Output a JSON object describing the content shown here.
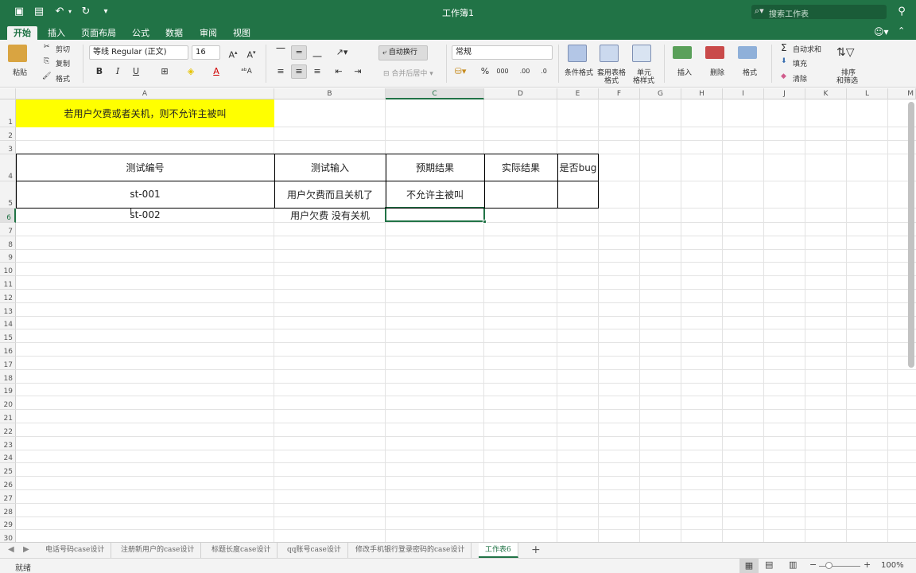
{
  "window": {
    "title": "工作簿1",
    "search_placeholder": "搜索工作表"
  },
  "colors": {
    "brand": "#217346",
    "highlight_yellow": "#ffff00"
  },
  "ribbon_tabs": [
    "开始",
    "插入",
    "页面布局",
    "公式",
    "数据",
    "审阅",
    "视图"
  ],
  "ribbon": {
    "paste": "粘贴",
    "cut": "剪切",
    "copy": "复制",
    "format_painter": "格式",
    "font_name": "等线 Regular (正文)",
    "font_size": "16",
    "wrap_text": "自动换行",
    "merge_center": "合并后居中",
    "number_format": "常规",
    "percent": "%",
    "thousands": "000",
    "inc_decimal": ".00",
    "dec_decimal": ".0",
    "conditional_format": "条件格式",
    "table_format_1": "套用表格",
    "table_format_2": "格式",
    "cell_style_1": "单元",
    "cell_style_2": "格样式",
    "insert": "插入",
    "delete": "删除",
    "format": "格式",
    "autosum": "自动求和",
    "fill": "填充",
    "clear": "清除",
    "sort_1": "排序",
    "sort_2": "和筛选"
  },
  "columns": [
    "A",
    "B",
    "C",
    "D",
    "E",
    "F",
    "G",
    "H",
    "I",
    "J",
    "K",
    "L",
    "M"
  ],
  "rows": [
    "1",
    "2",
    "3",
    "4",
    "5",
    "6",
    "7",
    "8",
    "9",
    "10",
    "11",
    "12",
    "13",
    "14",
    "15",
    "16",
    "17",
    "18",
    "19",
    "20",
    "21",
    "22",
    "23",
    "24",
    "25",
    "26",
    "27",
    "28",
    "29",
    "30"
  ],
  "cells": {
    "A1": "若用户欠费或者关机，则不允许主被叫",
    "A4": "测试编号",
    "B4": "测试输入",
    "C4": "预期结果",
    "D4": "实际结果",
    "E4": "是否bug",
    "A5": "st-001",
    "B5": "用户欠费而且关机了",
    "C5": "不允许主被叫",
    "A6": "st-002",
    "B6": "用户欠费 没有关机"
  },
  "sheet_tabs": [
    "电话号码case设计",
    "注册新用户的case设计",
    "标题长度case设计",
    "qq账号case设计",
    "修改手机银行登录密码的case设计",
    "工作表6"
  ],
  "status": {
    "ready": "就绪",
    "zoom": "100%"
  }
}
